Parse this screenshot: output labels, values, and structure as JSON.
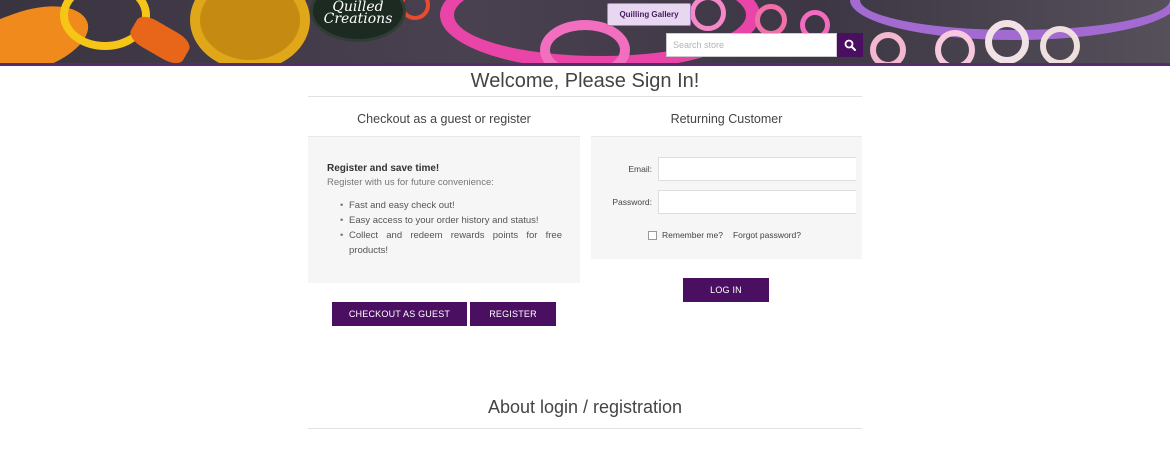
{
  "header": {
    "logo_line1": "Quilled",
    "logo_line2": "Creations",
    "gallery_label": "Quilling Gallery",
    "search_placeholder": "Search store",
    "colors": {
      "accent": "#4b0f62",
      "header_border": "#5a2a6e"
    }
  },
  "main": {
    "title": "Welcome, Please Sign In!",
    "guest": {
      "title": "Checkout as a guest or register",
      "heading": "Register and save time!",
      "subtext": "Register with us for future convenience:",
      "benefits": [
        "Fast and easy check out!",
        "Easy access to your order history and status!",
        "Collect and redeem rewards points for free products!"
      ],
      "checkout_guest_label": "CHECKOUT AS GUEST",
      "register_label": "REGISTER"
    },
    "returning": {
      "title": "Returning Customer",
      "email_label": "Email:",
      "password_label": "Password:",
      "email_value": "",
      "password_value": "",
      "remember_label": "Remember me?",
      "forgot_label": "Forgot password?",
      "login_label": "LOG IN"
    },
    "about_title": "About login / registration"
  }
}
